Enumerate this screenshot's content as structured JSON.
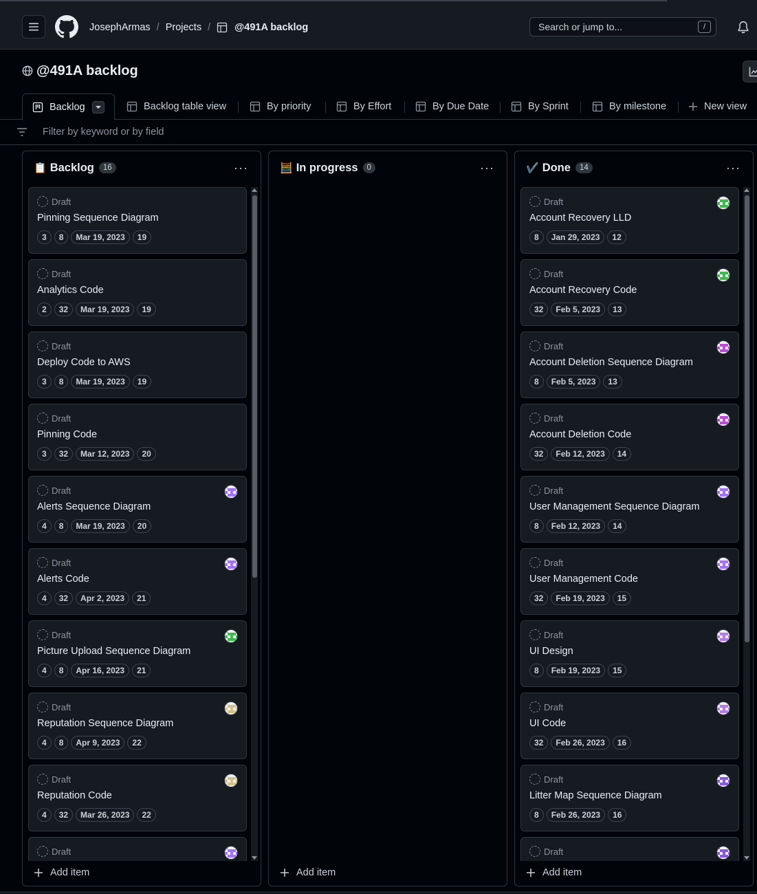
{
  "header": {
    "breadcrumb": {
      "owner": "JosephArmas",
      "section": "Projects",
      "project": "@491A backlog"
    },
    "search": {
      "placeholder": "Search or jump to...",
      "shortcut": "/"
    }
  },
  "project": {
    "title": "@491A backlog"
  },
  "tabs": [
    {
      "label": "Backlog",
      "icon": "board-icon",
      "active": true
    },
    {
      "label": "Backlog table view",
      "icon": "table-icon"
    },
    {
      "label": "By priority",
      "icon": "table-icon"
    },
    {
      "label": "By Effort",
      "icon": "table-icon"
    },
    {
      "label": "By Due Date",
      "icon": "table-icon"
    },
    {
      "label": "By Sprint",
      "icon": "table-icon"
    },
    {
      "label": "By milestone",
      "icon": "table-icon"
    },
    {
      "label": "New view",
      "icon": "plus-icon"
    }
  ],
  "filter": {
    "placeholder": "Filter by keyword or by field"
  },
  "columns": [
    {
      "emoji": "📋",
      "name": "Backlog",
      "count": "16",
      "add_label": "Add item",
      "cards": [
        {
          "status": "Draft",
          "title": "Pinning Sequence Diagram",
          "tags": [
            "3",
            "8",
            "Mar 19, 2023",
            "19"
          ]
        },
        {
          "status": "Draft",
          "title": "Analytics Code",
          "tags": [
            "2",
            "32",
            "Mar 19, 2023",
            "19"
          ]
        },
        {
          "status": "Draft",
          "title": "Deploy Code to AWS",
          "tags": [
            "3",
            "8",
            "Mar 19, 2023",
            "19"
          ]
        },
        {
          "status": "Draft",
          "title": "Pinning Code",
          "tags": [
            "3",
            "32",
            "Mar 12, 2023",
            "20"
          ]
        },
        {
          "status": "Draft",
          "title": "Alerts Sequence Diagram",
          "tags": [
            "4",
            "8",
            "Mar 19, 2023",
            "20"
          ],
          "avatar": "#a371f7"
        },
        {
          "status": "Draft",
          "title": "Alerts Code",
          "tags": [
            "4",
            "32",
            "Apr 2, 2023",
            "21"
          ],
          "avatar": "#a371f7"
        },
        {
          "status": "Draft",
          "title": "Picture Upload Sequence Diagram",
          "tags": [
            "4",
            "8",
            "Apr 16, 2023",
            "21"
          ],
          "avatar": "#3fb950"
        },
        {
          "status": "Draft",
          "title": "Reputation Sequence Diagram",
          "tags": [
            "4",
            "8",
            "Apr 9, 2023",
            "22"
          ],
          "avatar": "#d4c08a"
        },
        {
          "status": "Draft",
          "title": "Reputation Code",
          "tags": [
            "4",
            "32",
            "Mar 26, 2023",
            "22"
          ],
          "avatar": "#d4c08a"
        },
        {
          "status": "Draft",
          "title": "",
          "tags": [],
          "avatar": "#a371f7"
        }
      ]
    },
    {
      "emoji": "🧮",
      "name": "In progress",
      "count": "0",
      "add_label": "Add item",
      "cards": []
    },
    {
      "emoji": "✔️",
      "name": "Done",
      "count": "14",
      "add_label": "Add item",
      "cards": [
        {
          "status": "Draft",
          "title": "Account Recovery LLD",
          "tags": [
            "8",
            "Jan 29, 2023",
            "12"
          ],
          "avatar": "#3fb950"
        },
        {
          "status": "Draft",
          "title": "Account Recovery Code",
          "tags": [
            "32",
            "Feb 5, 2023",
            "13"
          ],
          "avatar": "#3fb950"
        },
        {
          "status": "Draft",
          "title": "Account Deletion Sequence Diagram",
          "tags": [
            "8",
            "Feb 5, 2023",
            "13"
          ],
          "avatar": "#bc4cd6"
        },
        {
          "status": "Draft",
          "title": "Account Deletion Code",
          "tags": [
            "32",
            "Feb 12, 2023",
            "14"
          ],
          "avatar": "#bc4cd6"
        },
        {
          "status": "Draft",
          "title": "User Management Sequence Diagram",
          "tags": [
            "8",
            "Feb 12, 2023",
            "14"
          ],
          "avatar": "#a371f7"
        },
        {
          "status": "Draft",
          "title": "User Management Code",
          "tags": [
            "32",
            "Feb 19, 2023",
            "15"
          ],
          "avatar": "#a371f7"
        },
        {
          "status": "Draft",
          "title": "UI Design",
          "tags": [
            "8",
            "Feb 19, 2023",
            "15"
          ],
          "avatar": "#b57be6"
        },
        {
          "status": "Draft",
          "title": "UI Code",
          "tags": [
            "32",
            "Feb 26, 2023",
            "16"
          ],
          "avatar": "#b57be6"
        },
        {
          "status": "Draft",
          "title": "Litter Map Sequence Diagram",
          "tags": [
            "8",
            "Feb 26, 2023",
            "16"
          ],
          "avatar": "#8957e5"
        },
        {
          "status": "Draft",
          "title": "",
          "tags": [],
          "avatar": "#8957e5"
        }
      ]
    }
  ]
}
